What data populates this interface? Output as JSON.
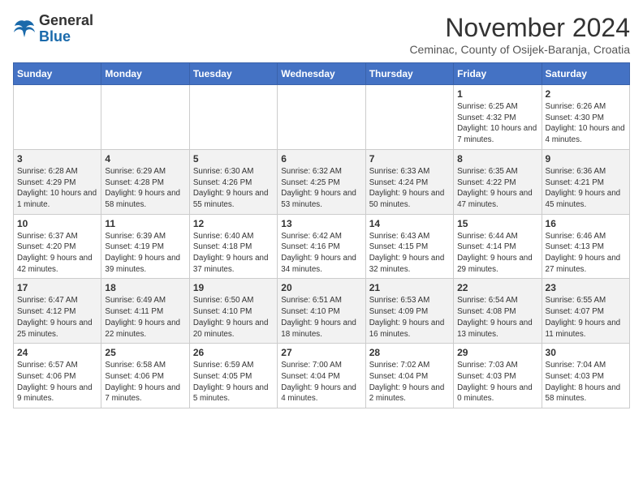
{
  "header": {
    "logo_general": "General",
    "logo_blue": "Blue",
    "month_title": "November 2024",
    "subtitle": "Ceminac, County of Osijek-Baranja, Croatia"
  },
  "days_of_week": [
    "Sunday",
    "Monday",
    "Tuesday",
    "Wednesday",
    "Thursday",
    "Friday",
    "Saturday"
  ],
  "weeks": [
    [
      {
        "day": "",
        "info": ""
      },
      {
        "day": "",
        "info": ""
      },
      {
        "day": "",
        "info": ""
      },
      {
        "day": "",
        "info": ""
      },
      {
        "day": "",
        "info": ""
      },
      {
        "day": "1",
        "info": "Sunrise: 6:25 AM\nSunset: 4:32 PM\nDaylight: 10 hours and 7 minutes."
      },
      {
        "day": "2",
        "info": "Sunrise: 6:26 AM\nSunset: 4:30 PM\nDaylight: 10 hours and 4 minutes."
      }
    ],
    [
      {
        "day": "3",
        "info": "Sunrise: 6:28 AM\nSunset: 4:29 PM\nDaylight: 10 hours and 1 minute."
      },
      {
        "day": "4",
        "info": "Sunrise: 6:29 AM\nSunset: 4:28 PM\nDaylight: 9 hours and 58 minutes."
      },
      {
        "day": "5",
        "info": "Sunrise: 6:30 AM\nSunset: 4:26 PM\nDaylight: 9 hours and 55 minutes."
      },
      {
        "day": "6",
        "info": "Sunrise: 6:32 AM\nSunset: 4:25 PM\nDaylight: 9 hours and 53 minutes."
      },
      {
        "day": "7",
        "info": "Sunrise: 6:33 AM\nSunset: 4:24 PM\nDaylight: 9 hours and 50 minutes."
      },
      {
        "day": "8",
        "info": "Sunrise: 6:35 AM\nSunset: 4:22 PM\nDaylight: 9 hours and 47 minutes."
      },
      {
        "day": "9",
        "info": "Sunrise: 6:36 AM\nSunset: 4:21 PM\nDaylight: 9 hours and 45 minutes."
      }
    ],
    [
      {
        "day": "10",
        "info": "Sunrise: 6:37 AM\nSunset: 4:20 PM\nDaylight: 9 hours and 42 minutes."
      },
      {
        "day": "11",
        "info": "Sunrise: 6:39 AM\nSunset: 4:19 PM\nDaylight: 9 hours and 39 minutes."
      },
      {
        "day": "12",
        "info": "Sunrise: 6:40 AM\nSunset: 4:18 PM\nDaylight: 9 hours and 37 minutes."
      },
      {
        "day": "13",
        "info": "Sunrise: 6:42 AM\nSunset: 4:16 PM\nDaylight: 9 hours and 34 minutes."
      },
      {
        "day": "14",
        "info": "Sunrise: 6:43 AM\nSunset: 4:15 PM\nDaylight: 9 hours and 32 minutes."
      },
      {
        "day": "15",
        "info": "Sunrise: 6:44 AM\nSunset: 4:14 PM\nDaylight: 9 hours and 29 minutes."
      },
      {
        "day": "16",
        "info": "Sunrise: 6:46 AM\nSunset: 4:13 PM\nDaylight: 9 hours and 27 minutes."
      }
    ],
    [
      {
        "day": "17",
        "info": "Sunrise: 6:47 AM\nSunset: 4:12 PM\nDaylight: 9 hours and 25 minutes."
      },
      {
        "day": "18",
        "info": "Sunrise: 6:49 AM\nSunset: 4:11 PM\nDaylight: 9 hours and 22 minutes."
      },
      {
        "day": "19",
        "info": "Sunrise: 6:50 AM\nSunset: 4:10 PM\nDaylight: 9 hours and 20 minutes."
      },
      {
        "day": "20",
        "info": "Sunrise: 6:51 AM\nSunset: 4:10 PM\nDaylight: 9 hours and 18 minutes."
      },
      {
        "day": "21",
        "info": "Sunrise: 6:53 AM\nSunset: 4:09 PM\nDaylight: 9 hours and 16 minutes."
      },
      {
        "day": "22",
        "info": "Sunrise: 6:54 AM\nSunset: 4:08 PM\nDaylight: 9 hours and 13 minutes."
      },
      {
        "day": "23",
        "info": "Sunrise: 6:55 AM\nSunset: 4:07 PM\nDaylight: 9 hours and 11 minutes."
      }
    ],
    [
      {
        "day": "24",
        "info": "Sunrise: 6:57 AM\nSunset: 4:06 PM\nDaylight: 9 hours and 9 minutes."
      },
      {
        "day": "25",
        "info": "Sunrise: 6:58 AM\nSunset: 4:06 PM\nDaylight: 9 hours and 7 minutes."
      },
      {
        "day": "26",
        "info": "Sunrise: 6:59 AM\nSunset: 4:05 PM\nDaylight: 9 hours and 5 minutes."
      },
      {
        "day": "27",
        "info": "Sunrise: 7:00 AM\nSunset: 4:04 PM\nDaylight: 9 hours and 4 minutes."
      },
      {
        "day": "28",
        "info": "Sunrise: 7:02 AM\nSunset: 4:04 PM\nDaylight: 9 hours and 2 minutes."
      },
      {
        "day": "29",
        "info": "Sunrise: 7:03 AM\nSunset: 4:03 PM\nDaylight: 9 hours and 0 minutes."
      },
      {
        "day": "30",
        "info": "Sunrise: 7:04 AM\nSunset: 4:03 PM\nDaylight: 8 hours and 58 minutes."
      }
    ]
  ]
}
